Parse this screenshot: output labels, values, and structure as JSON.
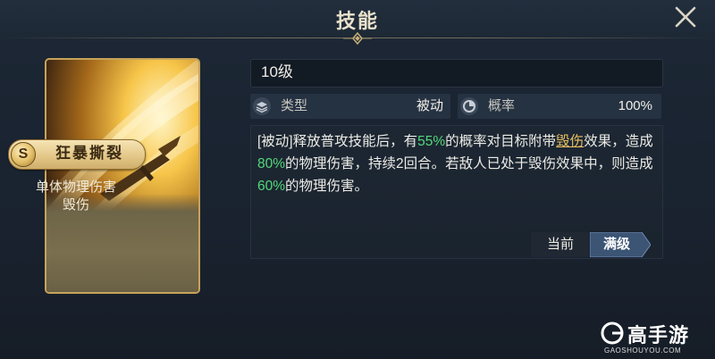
{
  "window": {
    "title": "技能"
  },
  "skill_card": {
    "rank_badge": "S",
    "name": "狂暴撕裂",
    "description_line1": "单体物理伤害",
    "description_line2": "毁伤"
  },
  "detail": {
    "level": "10级",
    "type_label": "类型",
    "type_value": "被动",
    "rate_label": "概率",
    "rate_value": "100%",
    "description": {
      "t1": "[被动]释放普攻技能后，有",
      "v1": "55%",
      "t2": "的概率对目标附带",
      "kw": "毁伤",
      "t3": "效果，造成",
      "v2": "80%",
      "t4": "的物理伤害，持续2回合。若敌人已处于毁伤效果中，则造成",
      "v3": "60%",
      "t5": "的物理伤害。"
    }
  },
  "tabs": {
    "current_label": "当前",
    "max_label": "满级"
  },
  "watermark": {
    "text": "高手游",
    "sub": "GAOSHOUYOU.COM"
  },
  "icons": {
    "close": "close-icon",
    "type": "layers-icon",
    "rate": "pie-chart-icon",
    "title_ornament": "diamond-ornament-icon"
  },
  "colors": {
    "highlight_value": "#52d97a",
    "keyword": "#e9c062",
    "active_tab": "#3c5575",
    "card_border": "#c7a35a"
  }
}
